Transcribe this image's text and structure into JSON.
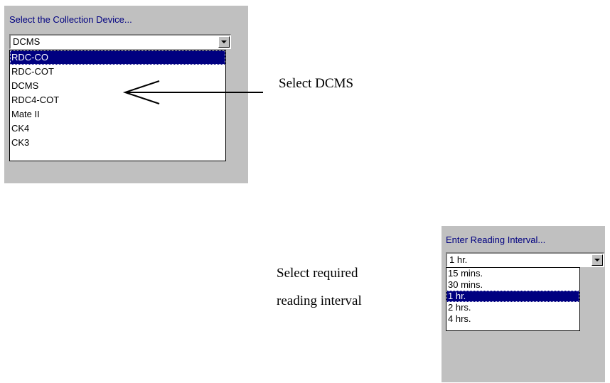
{
  "collection_device": {
    "caption": "Select the Collection Device...",
    "value": "DCMS",
    "options": [
      "RDC-CO",
      "RDC-COT",
      "DCMS",
      "RDC4-COT",
      "Mate II",
      "CK4",
      "CK3"
    ],
    "highlighted": "RDC-CO"
  },
  "reading_interval": {
    "caption": "Enter Reading Interval...",
    "value": "1 hr.",
    "options": [
      "15 mins.",
      "30 mins.",
      "1 hr.",
      "2 hrs.",
      "4 hrs."
    ],
    "highlighted": "1 hr."
  },
  "annotations": {
    "select_dcms": "Select DCMS",
    "interval_line1": "Select required",
    "interval_line2": "reading interval"
  },
  "colors": {
    "panel_bg": "#c0c0c0",
    "caption_text": "#000080",
    "selection_bg": "#000080",
    "selection_text": "#ffffff"
  }
}
